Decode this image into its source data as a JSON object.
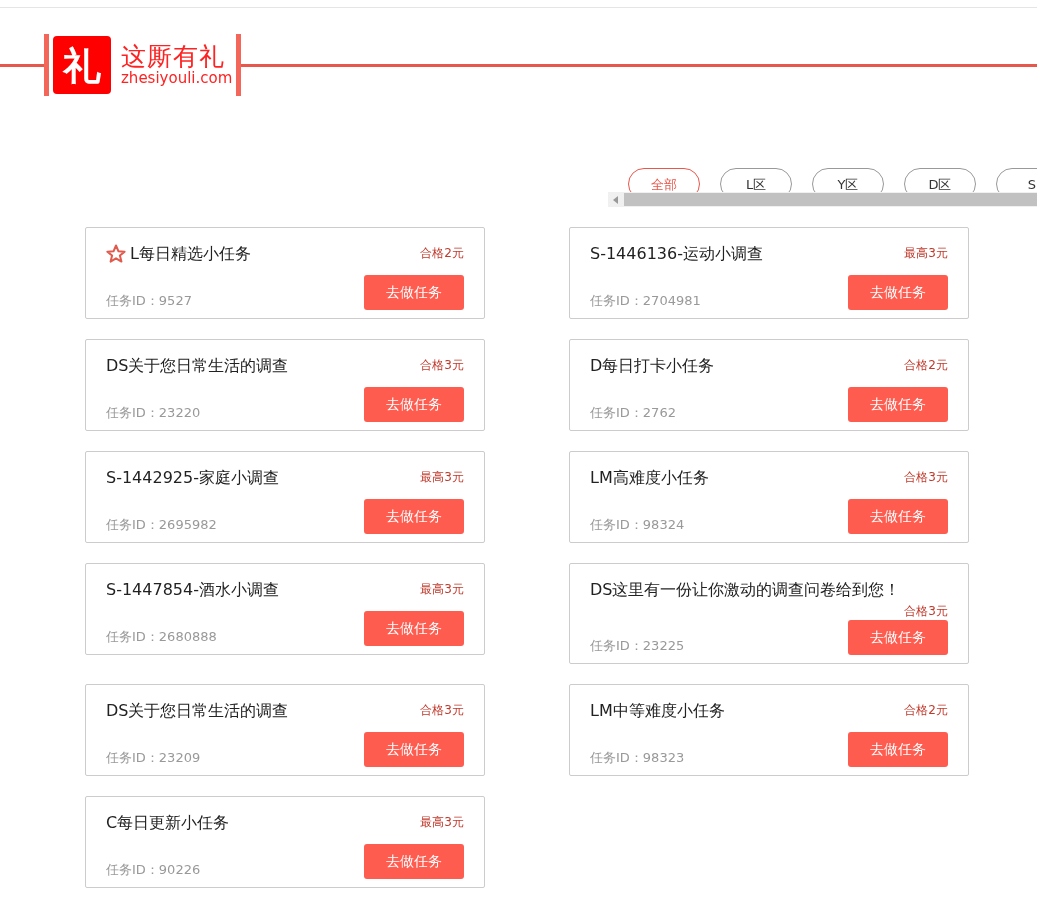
{
  "logo": {
    "mark": "礼",
    "name": "这厮有礼",
    "domain": "zhesiyouli.com"
  },
  "tabs": [
    {
      "label": "全部",
      "selected": true
    },
    {
      "label": "L区",
      "selected": false
    },
    {
      "label": "Y区",
      "selected": false
    },
    {
      "label": "D区",
      "selected": false
    },
    {
      "label": "S",
      "selected": false
    }
  ],
  "tasks": [
    {
      "title": "L每日精选小任务",
      "starred": true,
      "reward": "合格2元",
      "task_id": "任务ID：9527",
      "button": "去做任务"
    },
    {
      "title": "S-1446136-运动小调查",
      "starred": false,
      "reward": "最高3元",
      "task_id": "任务ID：2704981",
      "button": "去做任务"
    },
    {
      "title": "DS关于您日常生活的调查",
      "starred": false,
      "reward": "合格3元",
      "task_id": "任务ID：23220",
      "button": "去做任务"
    },
    {
      "title": "D每日打卡小任务",
      "starred": false,
      "reward": "合格2元",
      "task_id": "任务ID：2762",
      "button": "去做任务"
    },
    {
      "title": "S-1442925-家庭小调查",
      "starred": false,
      "reward": "最高3元",
      "task_id": "任务ID：2695982",
      "button": "去做任务"
    },
    {
      "title": "LM高难度小任务",
      "starred": false,
      "reward": "合格3元",
      "task_id": "任务ID：98324",
      "button": "去做任务"
    },
    {
      "title": "S-1447854-酒水小调查",
      "starred": false,
      "reward": "最高3元",
      "task_id": "任务ID：2680888",
      "button": "去做任务"
    },
    {
      "title": "DS这里有一份让你激动的调查问卷给到您！",
      "starred": false,
      "reward": "合格3元",
      "task_id": "任务ID：23225",
      "button": "去做任务"
    },
    {
      "title": "DS关于您日常生活的调查",
      "starred": false,
      "reward": "合格3元",
      "task_id": "任务ID：23209",
      "button": "去做任务"
    },
    {
      "title": "LM中等难度小任务",
      "starred": false,
      "reward": "合格2元",
      "task_id": "任务ID：98323",
      "button": "去做任务"
    },
    {
      "title": "C每日更新小任务",
      "starred": false,
      "reward": "最高3元",
      "task_id": "任务ID：90226",
      "button": "去做任务"
    }
  ]
}
